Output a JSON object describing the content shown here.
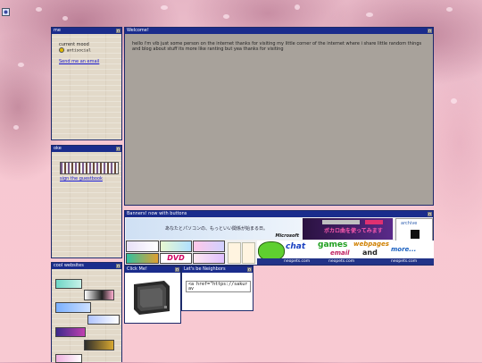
{
  "desktop_icon": "desktop-app-icon",
  "mood_window": {
    "title": "me",
    "label": "current mood",
    "mood": "antisocial",
    "mood_icon": "smiley-icon",
    "email_link": "Send me an email"
  },
  "welcome_window": {
    "title": "Welcome!",
    "text": "hello i'm vib just some person on the internet thanks for visiting my little corner of the internet where i share little random things and blog about stuff its more like ranting but yea thanks for visiting"
  },
  "guestbook_window": {
    "title": "oke",
    "link": "sign the guestbook"
  },
  "banners_window": {
    "title": "Banners! now with buttons",
    "jp_banner": "あなたとパソコンの、もっといい関係が始まる日。",
    "jp_brand": "Microsoft",
    "dimo_text": "ボカロ曲を使ってみます",
    "search_text": "archive",
    "chat_text": "chat",
    "games_text": "games",
    "email_text": "email",
    "webpages_text": "webpages",
    "and_text": "and",
    "more_text": "more...",
    "neopets_text": "neopets.com",
    "dvd_text": "DVD"
  },
  "websites_window": {
    "title": "cool websites"
  },
  "clickme_window": {
    "title": "Click Me!"
  },
  "neighbors_window": {
    "title": "Let's be Neighbors",
    "code": "<a href=\"https://sakurav"
  },
  "colors": {
    "titlebar": "#1a2c8c",
    "window_bg": "#ddd3c4",
    "main_bg": "#a8a29b",
    "link": "#1a1ad0",
    "pink_bg": "#f8c9d2"
  }
}
